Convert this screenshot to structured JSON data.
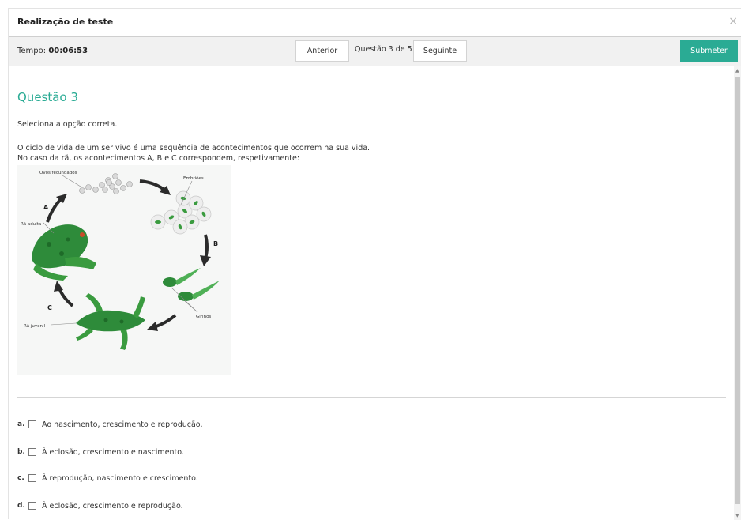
{
  "dialog": {
    "title": "Realização de teste",
    "close_glyph": "×"
  },
  "toolbar": {
    "timer_label": "Tempo:",
    "timer_value": "00:06:53",
    "prev_label": "Anterior",
    "question_count": "Questão 3 de 5",
    "next_label": "Seguinte",
    "submit_label": "Submeter"
  },
  "question": {
    "title": "Questão 3",
    "instruction": "Seleciona a opção correta.",
    "line1": "O ciclo de vida de um ser vivo é uma sequência de acontecimentos que ocorrem na sua vida.",
    "line2": "No caso da rã, os acontecimentos A, B e C correspondem, respetivamente:"
  },
  "figure": {
    "label_eggs": "Ovos fecundados",
    "label_embryos": "Embriões",
    "label_adult": "Rã adulta",
    "label_tadpoles": "Girinos",
    "label_juvenile": "Rã juvenil",
    "arrow_a": "A",
    "arrow_b": "B",
    "arrow_c": "C"
  },
  "options": [
    {
      "letter": "a.",
      "text": "Ao nascimento, crescimento e reprodução.",
      "checked": false
    },
    {
      "letter": "b.",
      "text": "À eclosão, crescimento e nascimento.",
      "checked": false
    },
    {
      "letter": "c.",
      "text": "À reprodução, nascimento e crescimento.",
      "checked": false
    },
    {
      "letter": "d.",
      "text": "À eclosão, crescimento e reprodução.",
      "checked": false
    }
  ],
  "colors": {
    "accent": "#2aab94",
    "frog_green": "#2e8b3a",
    "arrow": "#2b2b2b"
  }
}
